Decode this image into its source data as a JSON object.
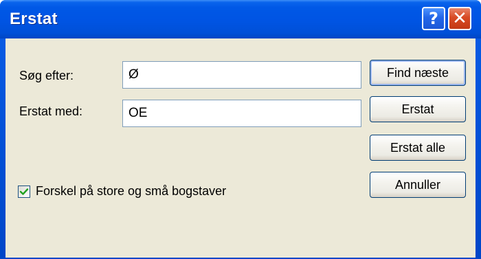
{
  "window": {
    "title": "Erstat"
  },
  "title_buttons": {
    "help_glyph": "?",
    "close_glyph": "✕"
  },
  "form": {
    "find_label": "Søg efter:",
    "find_value": "Ø",
    "replace_label": "Erstat med:",
    "replace_value": "OE"
  },
  "buttons": {
    "find_next": "Find næste",
    "replace": "Erstat",
    "replace_all": "Erstat alle",
    "cancel": "Annuller"
  },
  "options": {
    "match_case_label": "Forskel på store og små bogstaver",
    "match_case_checked": true
  },
  "colors": {
    "titlebar": "#0054e3",
    "dialog_bg": "#ece9d8",
    "close_button": "#d84a24",
    "checkmark": "#21a121"
  },
  "icons": {
    "help": "help-icon",
    "close": "close-icon",
    "check": "checkmark-icon"
  }
}
